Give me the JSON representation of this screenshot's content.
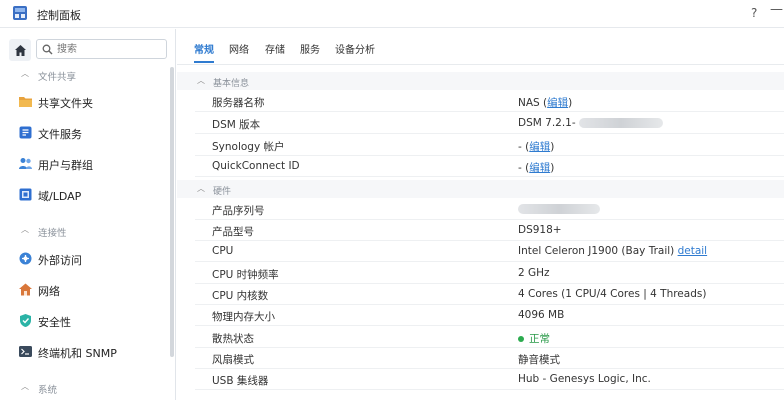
{
  "window": {
    "title": "控制面板",
    "help_glyph": "?",
    "minimize_glyph": "—"
  },
  "sidebar": {
    "search_placeholder": "搜索",
    "groups": [
      {
        "label": "文件共享"
      },
      {
        "label": "连接性"
      },
      {
        "label": "系统"
      }
    ],
    "items": [
      {
        "label": "共享文件夹",
        "icon": "folder-icon",
        "color": "#e8a33d"
      },
      {
        "label": "文件服务",
        "icon": "file-services-icon",
        "color": "#2f6fd0"
      },
      {
        "label": "用户与群组",
        "icon": "users-icon",
        "color": "#3b82d6"
      },
      {
        "label": "域/LDAP",
        "icon": "domain-icon",
        "color": "#2f6fd0"
      },
      {
        "label": "外部访问",
        "icon": "external-access-icon",
        "color": "#3b82d6"
      },
      {
        "label": "网络",
        "icon": "network-house-icon",
        "color": "#d9773a"
      },
      {
        "label": "安全性",
        "icon": "shield-icon",
        "color": "#2bb3a6"
      },
      {
        "label": "终端机和 SNMP",
        "icon": "terminal-icon",
        "color": "#3a4a5c"
      }
    ]
  },
  "tabs": [
    "常规",
    "网络",
    "存储",
    "服务",
    "设备分析"
  ],
  "active_tab": "常规",
  "sections": {
    "basic": {
      "title": "基本信息",
      "rows": [
        {
          "label": "服务器名称",
          "value": "NAS (",
          "link": "编辑",
          "suffix": ")"
        },
        {
          "label": "DSM 版本",
          "value": "DSM 7.2.1-"
        },
        {
          "label": "Synology 帐户",
          "value": "- (",
          "link": "编辑",
          "suffix": ")"
        },
        {
          "label": "QuickConnect ID",
          "value": "- (",
          "link": "编辑",
          "suffix": ")"
        }
      ]
    },
    "hardware": {
      "title": "硬件",
      "rows": [
        {
          "label": "产品序列号",
          "value": ""
        },
        {
          "label": "产品型号",
          "value": "DS918+"
        },
        {
          "label": "CPU",
          "value": "Intel Celeron J1900 (Bay Trail) ",
          "link": "detail"
        },
        {
          "label": "CPU 时钟频率",
          "value": "2 GHz"
        },
        {
          "label": "CPU 内核数",
          "value": "4 Cores (1 CPU/4 Cores | 4 Threads)"
        },
        {
          "label": "物理内存大小",
          "value": "4096 MB"
        },
        {
          "label": "散热状态",
          "value": "正常",
          "status_color": "#2cab4f"
        },
        {
          "label": "风扇模式",
          "value": "静音模式"
        },
        {
          "label": "USB 集线器",
          "value": "Hub - Genesys Logic, Inc."
        }
      ]
    }
  },
  "colors": {
    "accent": "#2f7bd0",
    "status_ok": "#2cab4f"
  }
}
